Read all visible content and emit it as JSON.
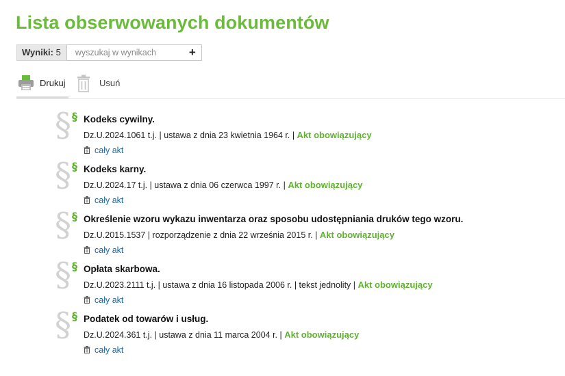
{
  "page": {
    "title": "Lista obserwowanych dokumentów"
  },
  "results": {
    "label": "Wyniki:",
    "count": "5",
    "search_placeholder": "wyszukaj w wynikach",
    "add_label": "+"
  },
  "toolbar": {
    "print_label": "Drukuj",
    "delete_label": "Usuń"
  },
  "documents": [
    {
      "title": "Kodeks cywilny.",
      "info": "Dz.U.2024.1061 t.j. | ustawa z dnia 23 kwietnia 1964 r. | ",
      "status": "Akt obowiązujący",
      "action": "cały akt"
    },
    {
      "title": "Kodeks karny.",
      "info": "Dz.U.2024.17 t.j. | ustawa z dnia 06 czerwca 1997 r. | ",
      "status": "Akt obowiązujący",
      "action": "cały akt"
    },
    {
      "title": "Określenie wzoru wykazu inwentarza oraz sposobu udostępniania druków tego wzoru.",
      "info": "Dz.U.2015.1537 | rozporządzenie z dnia 22 września 2015 r. | ",
      "status": "Akt obowiązujący",
      "action": "cały akt"
    },
    {
      "title": "Opłata skarbowa.",
      "info": "Dz.U.2023.2111 t.j. | ustawa z dnia 16 listopada 2006 r. | tekst jednolity | ",
      "status": "Akt obowiązujący",
      "action": "cały akt"
    },
    {
      "title": "Podatek od towarów i usług.",
      "info": "Dz.U.2024.361 t.j. | ustawa z dnia 11 marca 2004 r. | ",
      "status": "Akt obowiązujący",
      "action": "cały akt"
    }
  ],
  "icons": {
    "paragraph_symbol": "§",
    "print": "printer-icon",
    "delete": "trash-icon",
    "action": "trash-icon"
  },
  "colors": {
    "accent": "#6bbb3b",
    "status": "#5fb32f",
    "link": "#1b6aa5"
  }
}
